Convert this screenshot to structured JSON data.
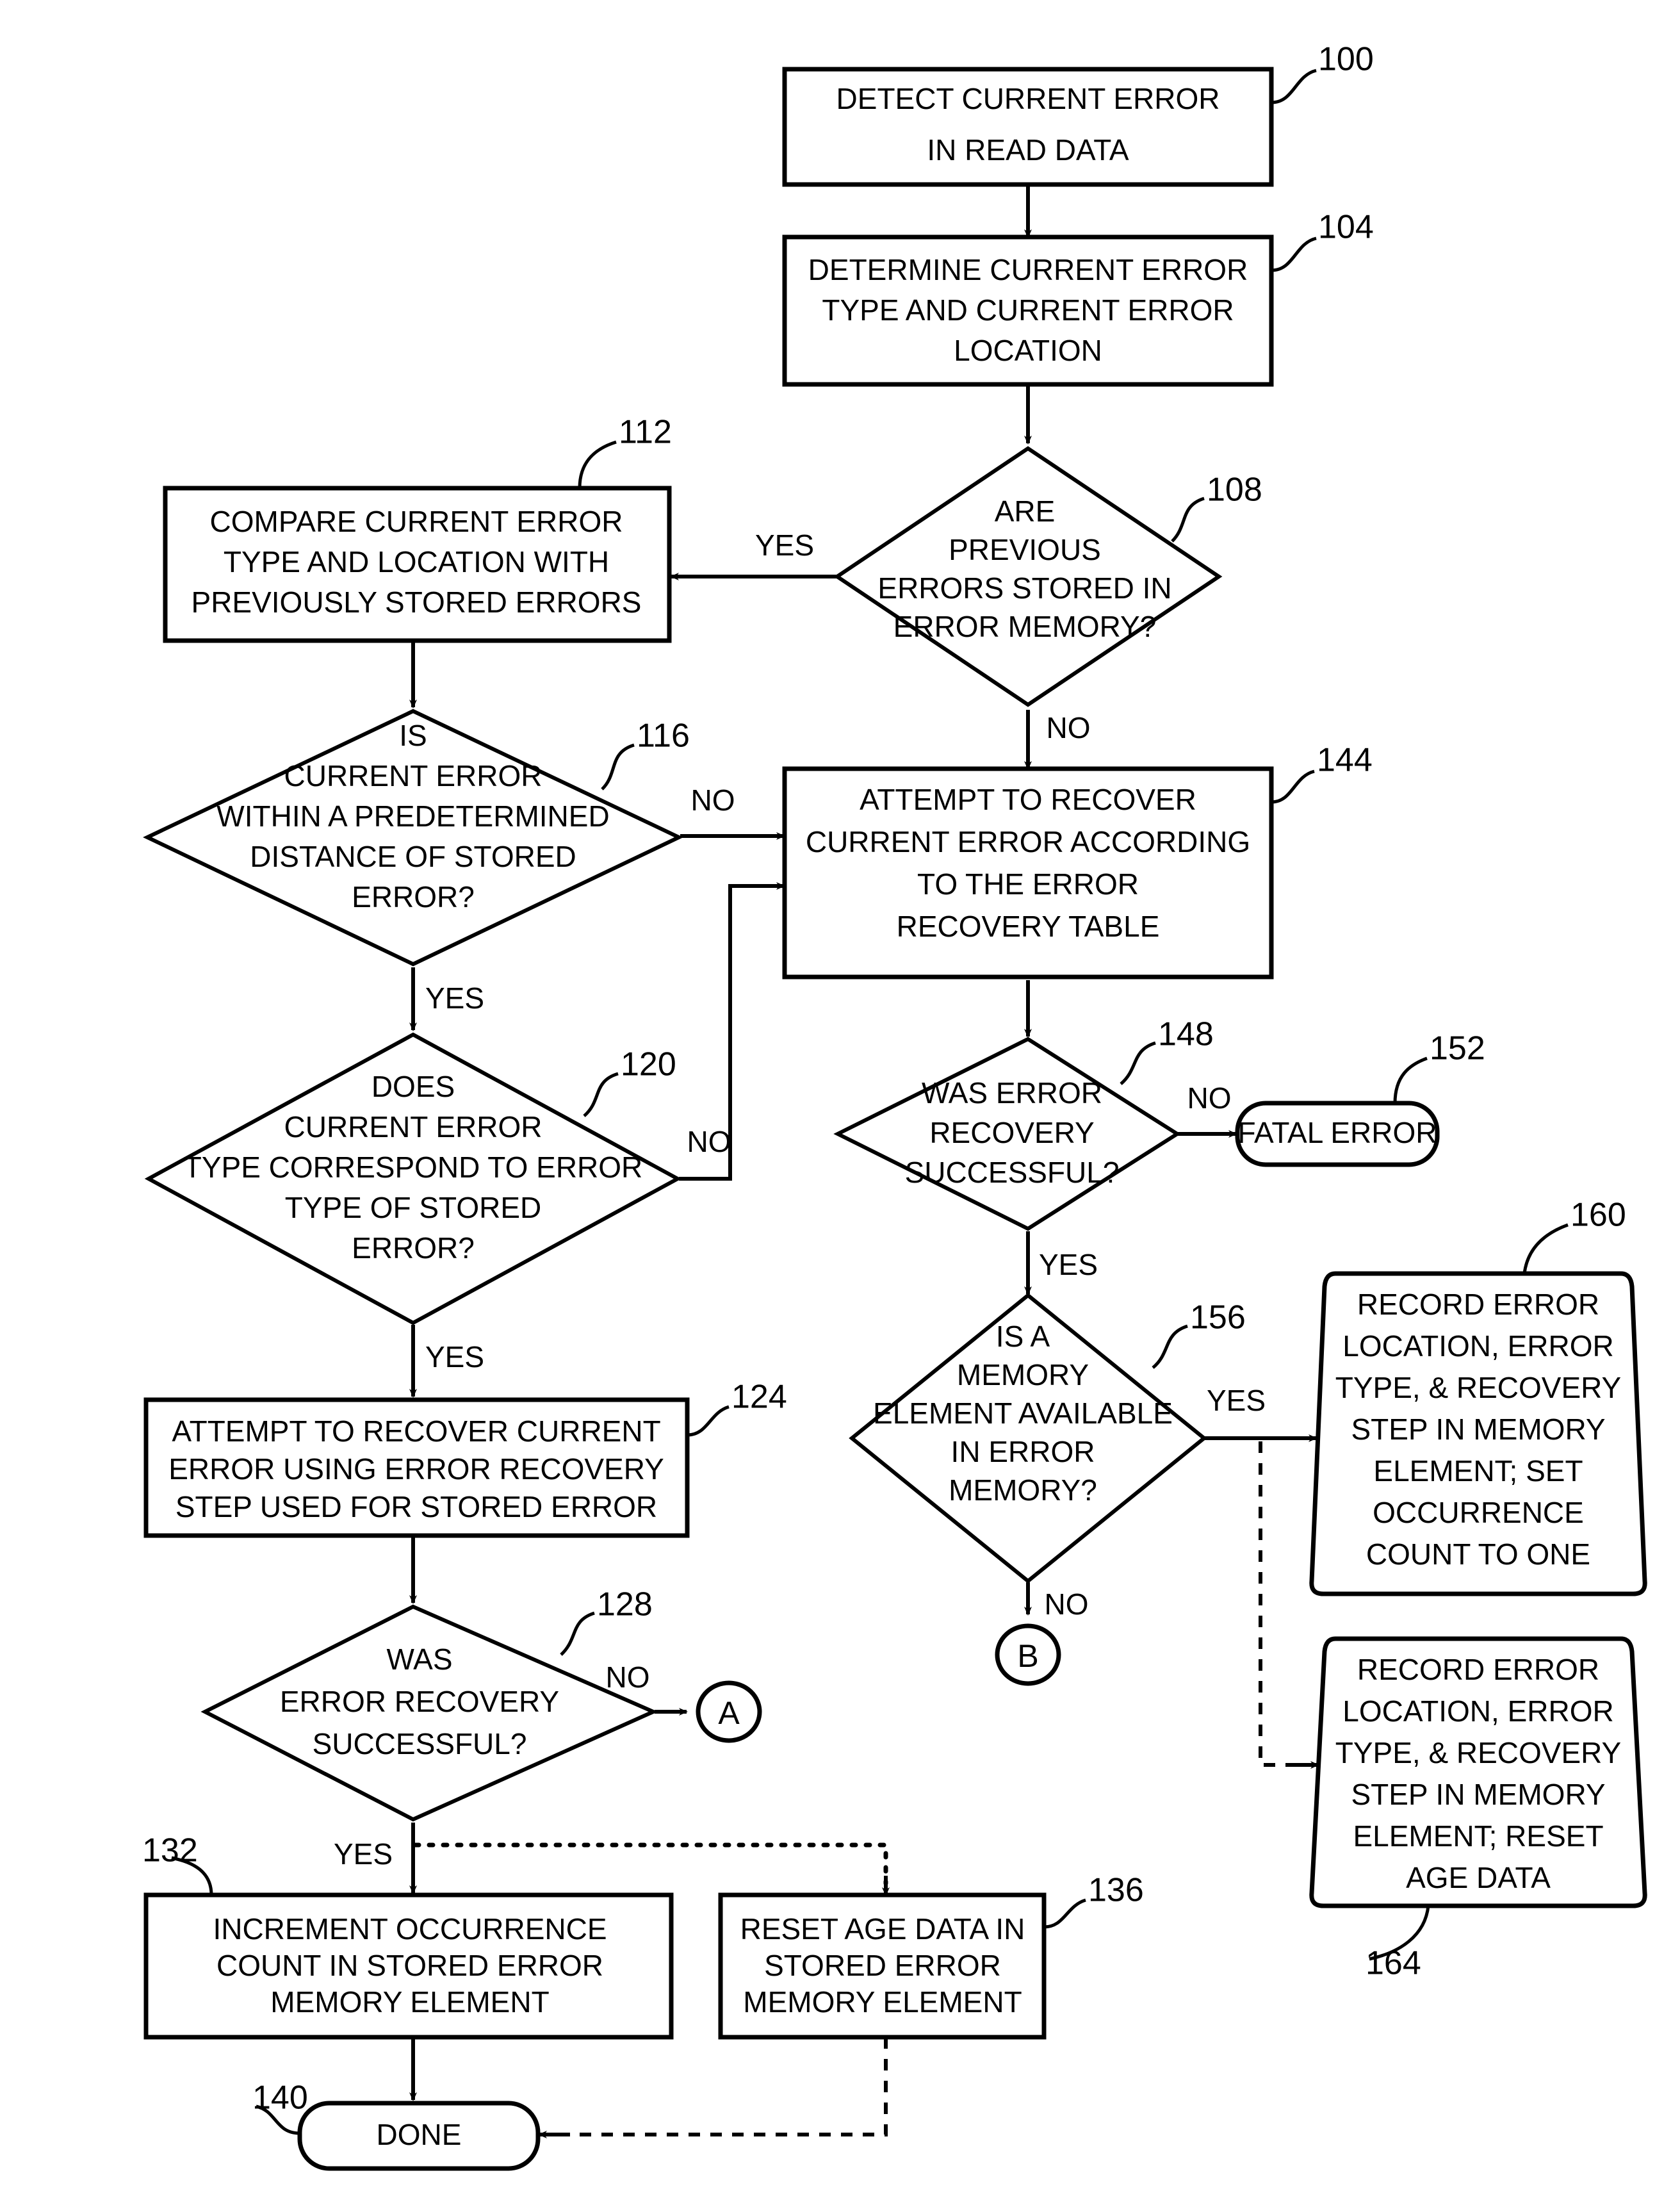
{
  "diagram": {
    "type": "flowchart",
    "nodes": {
      "n100": {
        "ref": "100",
        "shape": "process",
        "lines": [
          "DETECT CURRENT ERROR",
          "IN READ DATA"
        ]
      },
      "n104": {
        "ref": "104",
        "shape": "process",
        "lines": [
          "DETERMINE CURRENT ERROR",
          "TYPE AND CURRENT ERROR",
          "LOCATION"
        ]
      },
      "n108": {
        "ref": "108",
        "shape": "decision",
        "lines": [
          "ARE",
          "PREVIOUS",
          "ERRORS STORED IN",
          "ERROR MEMORY?"
        ]
      },
      "n112": {
        "ref": "112",
        "shape": "process",
        "lines": [
          "COMPARE CURRENT ERROR",
          "TYPE AND LOCATION WITH",
          "PREVIOUSLY STORED ERRORS"
        ]
      },
      "n116": {
        "ref": "116",
        "shape": "decision",
        "lines": [
          "IS",
          "CURRENT ERROR",
          "WITHIN A PREDETERMINED",
          "DISTANCE OF STORED",
          "ERROR?"
        ]
      },
      "n120": {
        "ref": "120",
        "shape": "decision",
        "lines": [
          "DOES",
          "CURRENT ERROR",
          "TYPE CORRESPOND TO ERROR",
          "TYPE OF STORED",
          "ERROR?"
        ]
      },
      "n124": {
        "ref": "124",
        "shape": "process",
        "lines": [
          "ATTEMPT TO RECOVER CURRENT",
          "ERROR USING ERROR RECOVERY",
          "STEP USED FOR STORED ERROR"
        ]
      },
      "n128": {
        "ref": "128",
        "shape": "decision",
        "lines": [
          "WAS",
          "ERROR RECOVERY",
          "SUCCESSFUL?"
        ]
      },
      "n132": {
        "ref": "132",
        "shape": "process",
        "lines": [
          "INCREMENT OCCURRENCE",
          "COUNT IN STORED ERROR",
          "MEMORY ELEMENT"
        ]
      },
      "n136": {
        "ref": "136",
        "shape": "process",
        "lines": [
          "RESET AGE DATA IN",
          "STORED ERROR",
          "MEMORY ELEMENT"
        ]
      },
      "n140": {
        "ref": "140",
        "shape": "terminator",
        "lines": [
          "DONE"
        ]
      },
      "n144": {
        "ref": "144",
        "shape": "process",
        "lines": [
          "ATTEMPT TO RECOVER",
          "CURRENT ERROR ACCORDING",
          "TO THE ERROR",
          "RECOVERY TABLE"
        ]
      },
      "n148": {
        "ref": "148",
        "shape": "decision",
        "lines": [
          "WAS ERROR",
          "RECOVERY",
          "SUCCESSFUL?"
        ]
      },
      "n152": {
        "ref": "152",
        "shape": "terminator",
        "lines": [
          "FATAL ERROR"
        ]
      },
      "n156": {
        "ref": "156",
        "shape": "decision",
        "lines": [
          "IS A",
          "MEMORY",
          "ELEMENT AVAILABLE",
          "IN ERROR",
          "MEMORY?"
        ]
      },
      "n160": {
        "ref": "160",
        "shape": "rounded-process",
        "lines": [
          "RECORD ERROR",
          "LOCATION, ERROR",
          "TYPE, & RECOVERY",
          "STEP IN MEMORY",
          "ELEMENT; SET",
          "OCCURRENCE",
          "COUNT TO ONE"
        ]
      },
      "n164": {
        "ref": "164",
        "shape": "rounded-process",
        "lines": [
          "RECORD ERROR",
          "LOCATION, ERROR",
          "TYPE, & RECOVERY",
          "STEP IN MEMORY",
          "ELEMENT; RESET",
          "AGE DATA"
        ]
      },
      "connA": {
        "shape": "connector",
        "label": "A"
      },
      "connB": {
        "shape": "connector",
        "label": "B"
      }
    },
    "edge_labels": {
      "e108_yes": "YES",
      "e108_no": "NO",
      "e116_no": "NO",
      "e116_yes": "YES",
      "e120_no": "NO",
      "e120_yes": "YES",
      "e128_no": "NO",
      "e128_yes": "YES",
      "e148_no": "NO",
      "e148_yes": "YES",
      "e156_yes": "YES",
      "e156_no": "NO"
    },
    "colors": {
      "ink": "#000000",
      "paper": "#ffffff"
    }
  }
}
